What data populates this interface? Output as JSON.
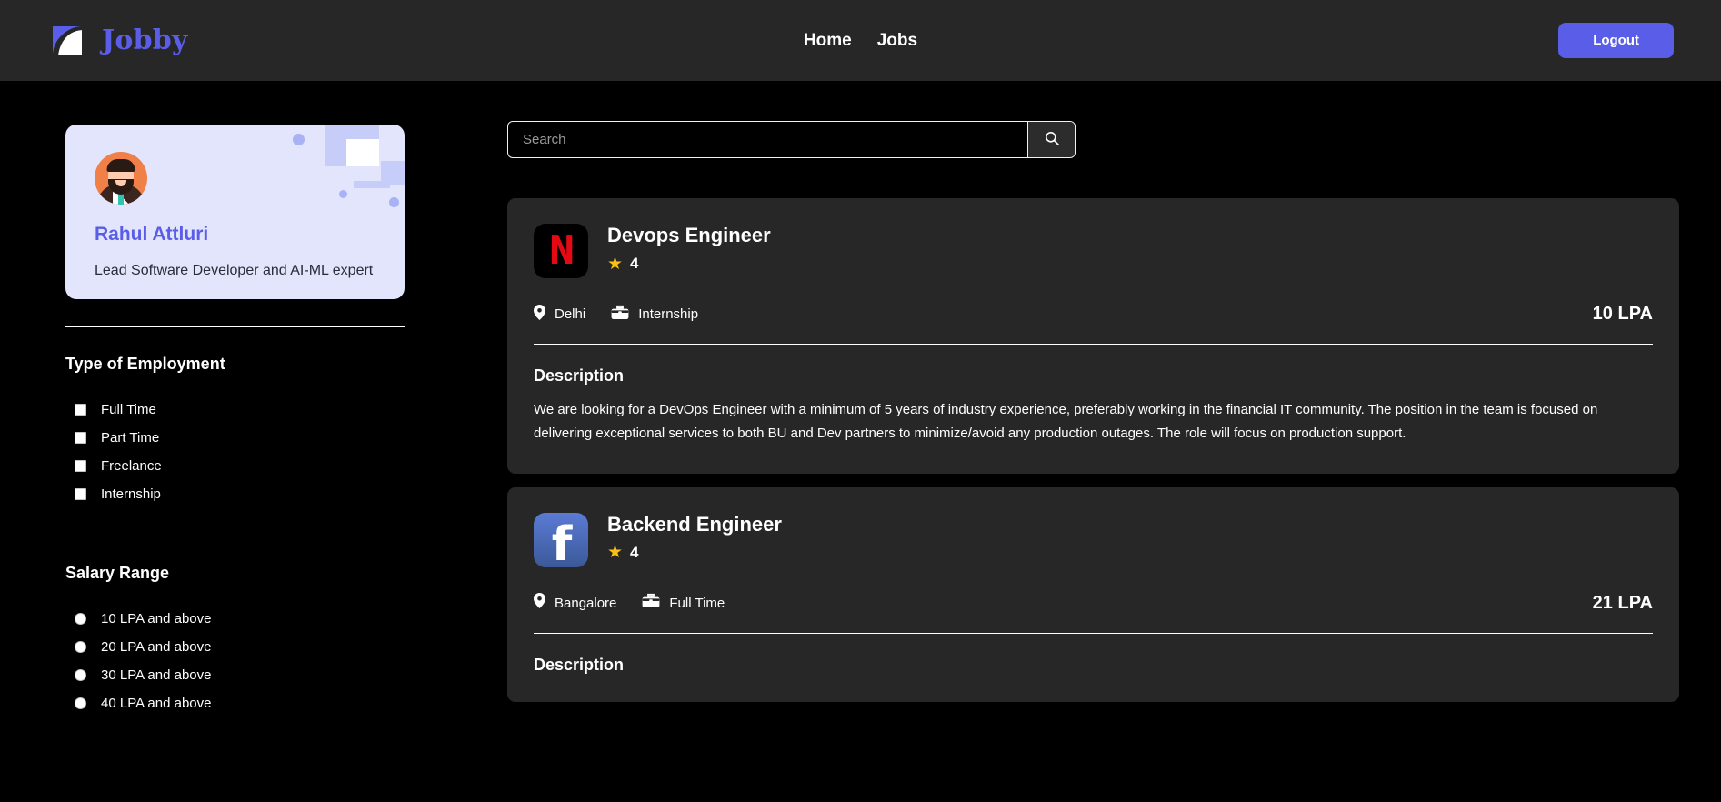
{
  "brand": {
    "name": "Jobby",
    "logo_icon": "jobby-logo-icon"
  },
  "nav": {
    "items": [
      {
        "label": "Home",
        "name": "nav-home"
      },
      {
        "label": "Jobs",
        "name": "nav-jobs"
      }
    ],
    "logout_label": "Logout"
  },
  "colors": {
    "accent": "#5a5de8",
    "page_bg": "#000000",
    "card_bg": "#272727",
    "profile_card_bg": "#e2e5fb",
    "star": "#fcc014",
    "netflix_red": "#e50914",
    "facebook_blue": "#3b5998"
  },
  "profile": {
    "name": "Rahul Attluri",
    "bio": "Lead Software Developer and AI-ML expert",
    "avatar_icon": "user-avatar"
  },
  "filters": {
    "employment": {
      "title": "Type of Employment",
      "options": [
        {
          "label": "Full Time",
          "checked": false
        },
        {
          "label": "Part Time",
          "checked": false
        },
        {
          "label": "Freelance",
          "checked": false
        },
        {
          "label": "Internship",
          "checked": false
        }
      ]
    },
    "salary": {
      "title": "Salary Range",
      "options": [
        {
          "label": "10 LPA and above",
          "selected": false
        },
        {
          "label": "20 LPA and above",
          "selected": false
        },
        {
          "label": "30 LPA and above",
          "selected": false
        },
        {
          "label": "40 LPA and above",
          "selected": false
        }
      ]
    }
  },
  "search": {
    "value": "",
    "placeholder": "Search",
    "button_icon": "search-icon"
  },
  "jobs": [
    {
      "company": "netflix",
      "company_logo_icon": "netflix-logo-icon",
      "title": "Devops Engineer",
      "rating": "4",
      "location": "Delhi",
      "location_icon": "location-pin-icon",
      "employment_type": "Internship",
      "employment_icon": "briefcase-icon",
      "salary": "10 LPA",
      "description_title": "Description",
      "description": "We are looking for a DevOps Engineer with a minimum of 5 years of industry experience, preferably working in the financial IT community. The position in the team is focused on delivering exceptional services to both BU and Dev partners to minimize/avoid any production outages. The role will focus on production support."
    },
    {
      "company": "facebook",
      "company_logo_icon": "facebook-logo-icon",
      "title": "Backend Engineer",
      "rating": "4",
      "location": "Bangalore",
      "location_icon": "location-pin-icon",
      "employment_type": "Full Time",
      "employment_icon": "briefcase-icon",
      "salary": "21 LPA",
      "description_title": "Description",
      "description": ""
    }
  ]
}
